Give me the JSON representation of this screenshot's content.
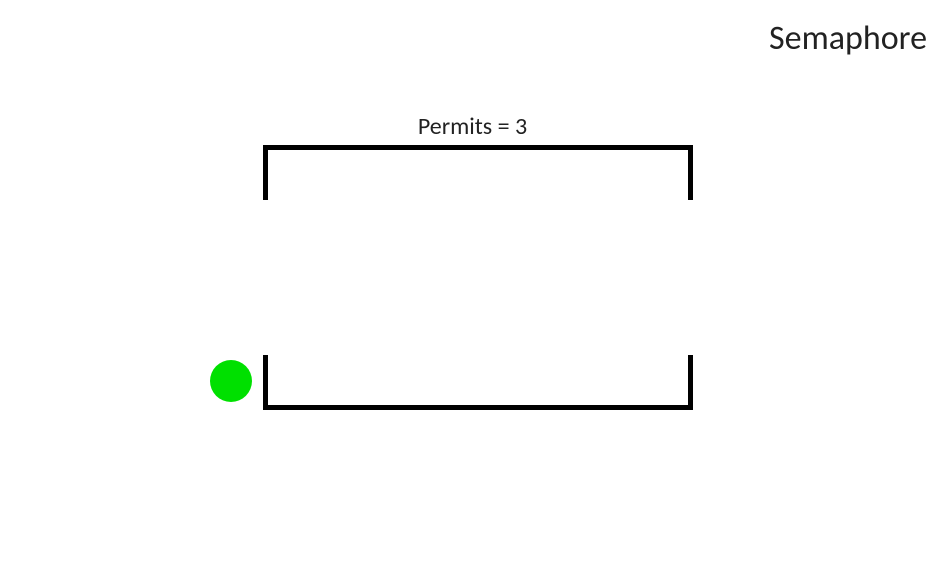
{
  "title": "Semaphore",
  "permits_label": "Permits = 3",
  "diagram": {
    "permits": 3,
    "queue_top": {
      "items": []
    },
    "queue_bottom": {
      "items": []
    },
    "token": {
      "color": "#00e000",
      "state": "waiting"
    }
  },
  "colors": {
    "token": "#00e000",
    "stroke": "#000000",
    "background": "#ffffff",
    "text": "#222222"
  }
}
